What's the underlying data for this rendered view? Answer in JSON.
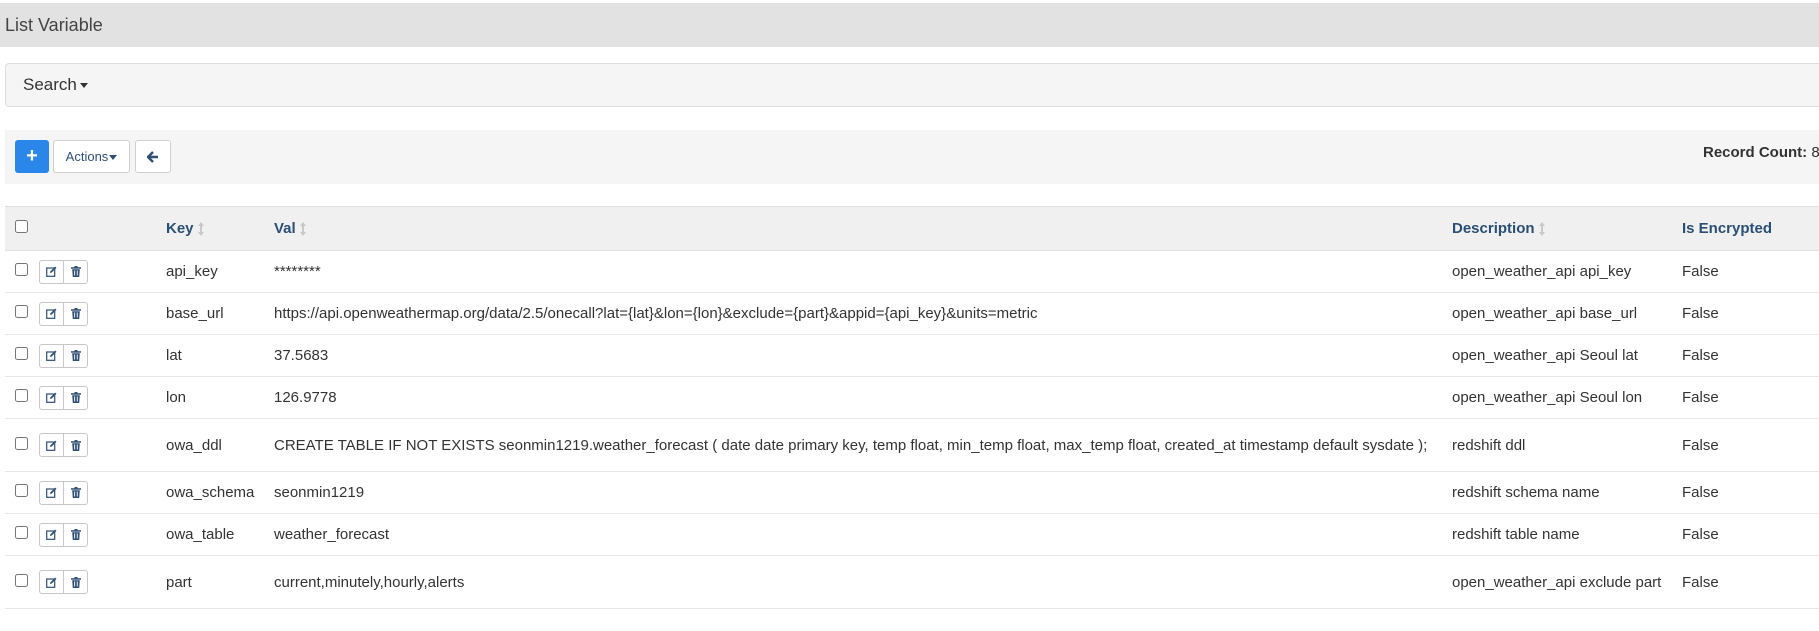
{
  "page": {
    "title": "List Variable"
  },
  "search": {
    "label": "Search"
  },
  "toolbar": {
    "add_label": "+",
    "actions_label": "Actions",
    "record_count_label": "Record Count:",
    "record_count_value": "8"
  },
  "table": {
    "headers": {
      "key": "Key",
      "val": "Val",
      "description": "Description",
      "is_encrypted": "Is Encrypted"
    },
    "rows": [
      {
        "key": "api_key",
        "val": "********",
        "description": "open_weather_api api_key",
        "is_encrypted": "False"
      },
      {
        "key": "base_url",
        "val": "https://api.openweathermap.org/data/2.5/onecall?lat={lat}&lon={lon}&exclude={part}&appid={api_key}&units=metric",
        "description": "open_weather_api base_url",
        "is_encrypted": "False"
      },
      {
        "key": "lat",
        "val": "37.5683",
        "description": "open_weather_api Seoul lat",
        "is_encrypted": "False"
      },
      {
        "key": "lon",
        "val": "126.9778",
        "description": "open_weather_api Seoul lon",
        "is_encrypted": "False"
      },
      {
        "key": "owa_ddl",
        "val": "CREATE TABLE IF NOT EXISTS seonmin1219.weather_forecast ( date date primary key, temp float, min_temp float, max_temp float, created_at timestamp default sysdate );",
        "description": "redshift ddl",
        "is_encrypted": "False"
      },
      {
        "key": "owa_schema",
        "val": "seonmin1219",
        "description": "redshift schema name",
        "is_encrypted": "False"
      },
      {
        "key": "owa_table",
        "val": "weather_forecast",
        "description": "redshift table name",
        "is_encrypted": "False"
      },
      {
        "key": "part",
        "val": "current,minutely,hourly,alerts",
        "description": "open_weather_api exclude part",
        "is_encrypted": "False"
      }
    ]
  },
  "colors": {
    "primary": "#2a86e8",
    "header_text": "#2a4f75",
    "panel_bg": "#f5f5f5",
    "title_bg": "#e2e2e2"
  },
  "icons": {
    "add": "plus-icon",
    "back": "arrow-left-icon",
    "edit": "edit-icon",
    "delete": "trash-icon",
    "sort": "sort-icon"
  }
}
